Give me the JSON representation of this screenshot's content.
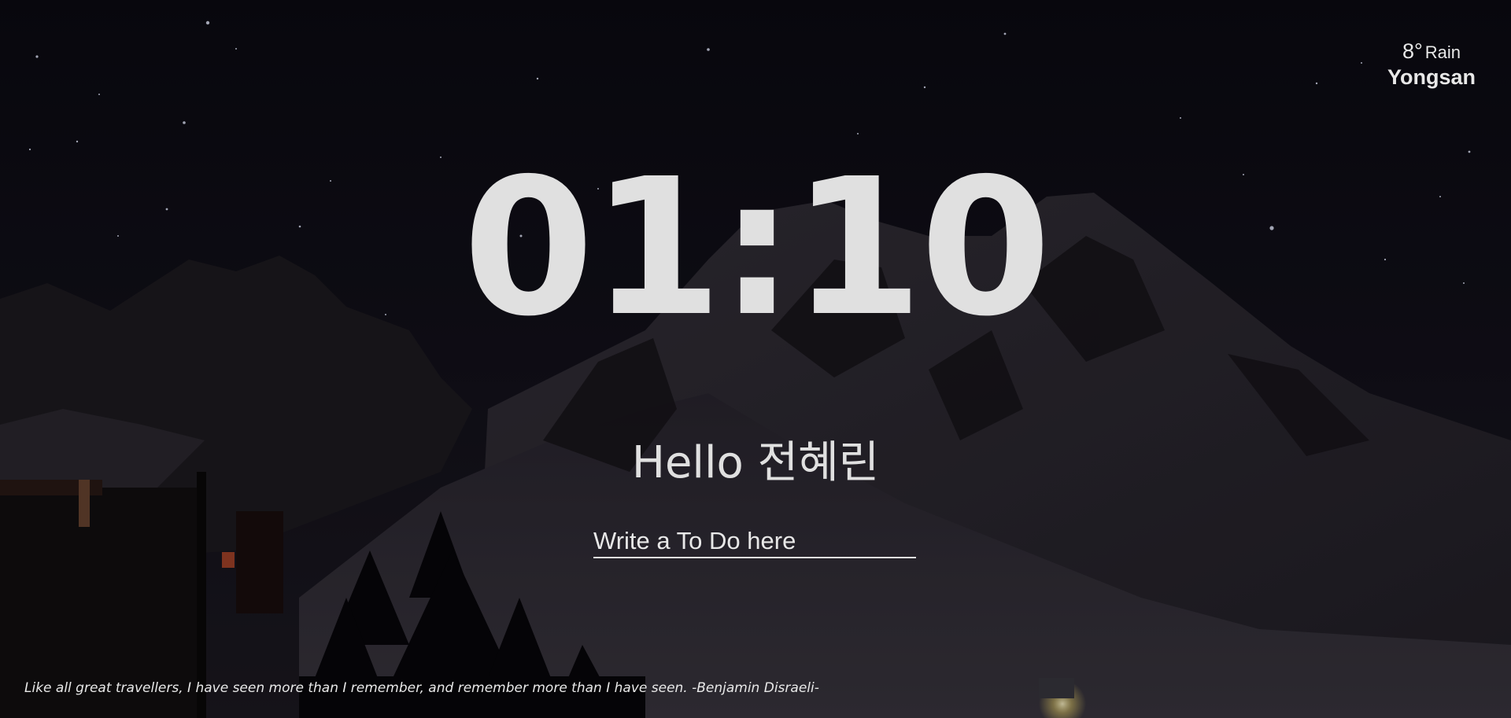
{
  "weather": {
    "temperature": "8°",
    "condition": "Rain",
    "city": "Yongsan"
  },
  "clock": {
    "time": "01:10"
  },
  "greeting": {
    "text": "Hello 전혜린"
  },
  "todo": {
    "placeholder": "Write a To Do here"
  },
  "quote": {
    "text": "Like all great travellers, I have seen more than I remember, and remember more than I have seen. -Benjamin Disraeli-"
  },
  "colors": {
    "text": "#e0e0e0",
    "sky": "#0d0c14",
    "snow": "#3a3640"
  }
}
